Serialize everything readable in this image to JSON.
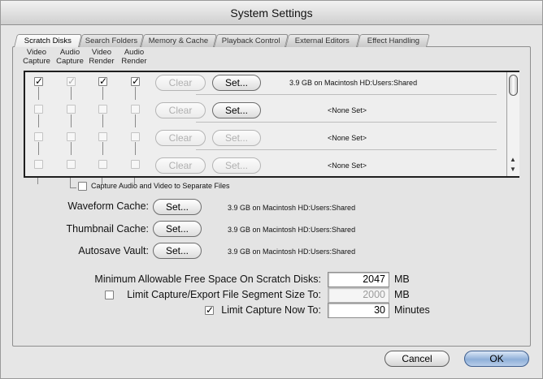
{
  "window": {
    "title": "System Settings"
  },
  "tabs": [
    {
      "label": "Scratch Disks",
      "active": true
    },
    {
      "label": "Search Folders",
      "active": false
    },
    {
      "label": "Memory & Cache",
      "active": false
    },
    {
      "label": "Playback Control",
      "active": false
    },
    {
      "label": "External Editors",
      "active": false
    },
    {
      "label": "Effect Handling",
      "active": false
    }
  ],
  "columns": {
    "video_capture": [
      "Video",
      "Capture"
    ],
    "audio_capture": [
      "Audio",
      "Capture"
    ],
    "video_render": [
      "Video",
      "Render"
    ],
    "audio_render": [
      "Audio",
      "Render"
    ]
  },
  "scratch_disks": [
    {
      "video_capture": true,
      "audio_capture": true,
      "video_render": true,
      "audio_render": true,
      "clear_label": "Clear",
      "clear_enabled": false,
      "set_label": "Set...",
      "set_enabled": true,
      "location": "3.9 GB on Macintosh HD:Users:Shared"
    },
    {
      "video_capture": false,
      "audio_capture": false,
      "video_render": false,
      "audio_render": false,
      "clear_label": "Clear",
      "clear_enabled": false,
      "set_label": "Set...",
      "set_enabled": true,
      "location": "<None Set>"
    },
    {
      "video_capture": false,
      "audio_capture": false,
      "video_render": false,
      "audio_render": false,
      "clear_label": "Clear",
      "clear_enabled": false,
      "set_label": "Set...",
      "set_enabled": false,
      "location": "<None Set>"
    },
    {
      "video_capture": false,
      "audio_capture": false,
      "video_render": false,
      "audio_render": false,
      "clear_label": "Clear",
      "clear_enabled": false,
      "set_label": "Set...",
      "set_enabled": false,
      "location": "<None Set>"
    }
  ],
  "separate_files": {
    "label": "Capture Audio and Video to Separate Files",
    "checked": false
  },
  "caches": [
    {
      "label": "Waveform Cache:",
      "set_label": "Set...",
      "location": "3.9 GB on Macintosh HD:Users:Shared"
    },
    {
      "label": "Thumbnail Cache:",
      "set_label": "Set...",
      "location": "3.9 GB on Macintosh HD:Users:Shared"
    },
    {
      "label": "Autosave Vault:",
      "set_label": "Set...",
      "location": "3.9 GB on Macintosh HD:Users:Shared"
    }
  ],
  "limits": {
    "min_free": {
      "label": "Minimum Allowable Free Space On Scratch Disks:",
      "value": "2047",
      "unit": "MB"
    },
    "segment": {
      "label": "Limit Capture/Export File Segment Size To:",
      "value": "2000",
      "unit": "MB",
      "checked": false
    },
    "capture_now": {
      "label": "Limit Capture Now To:",
      "value": "30",
      "unit": "Minutes",
      "checked": true
    }
  },
  "buttons": {
    "cancel": "Cancel",
    "ok": "OK"
  },
  "icons": {
    "checkmark": "✓",
    "scroll_up": "▲",
    "scroll_down": "▼"
  }
}
